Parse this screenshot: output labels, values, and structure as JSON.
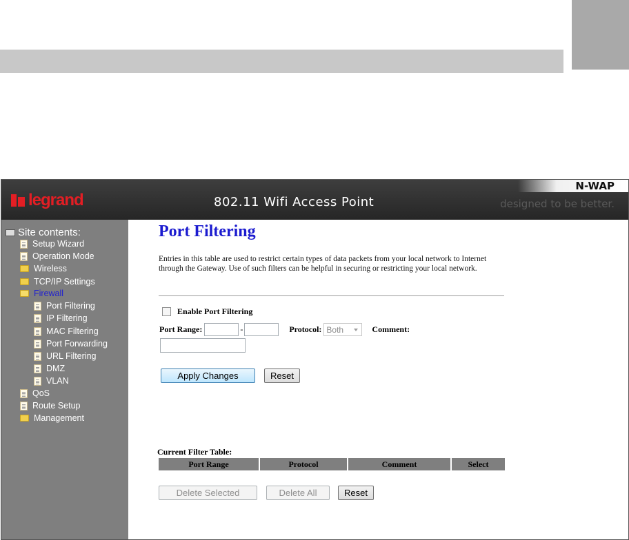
{
  "header": {
    "logo": "legrand",
    "title": "802.11 Wifi Access Point",
    "product": "N-WAP",
    "tagline": "designed to be better."
  },
  "sidebar": {
    "title": "Site contents:",
    "items": [
      {
        "label": "Setup Wizard",
        "icon": "document-icon"
      },
      {
        "label": "Operation Mode",
        "icon": "document-icon"
      },
      {
        "label": "Wireless",
        "icon": "folder-icon"
      },
      {
        "label": "TCP/IP Settings",
        "icon": "folder-icon"
      },
      {
        "label": "Firewall",
        "icon": "folder-open-icon",
        "active": true
      },
      {
        "label": "Port Filtering",
        "icon": "document-icon"
      },
      {
        "label": "IP Filtering",
        "icon": "document-icon"
      },
      {
        "label": "MAC Filtering",
        "icon": "document-icon"
      },
      {
        "label": "Port Forwarding",
        "icon": "document-icon"
      },
      {
        "label": "URL Filtering",
        "icon": "document-icon"
      },
      {
        "label": "DMZ",
        "icon": "document-icon"
      },
      {
        "label": "VLAN",
        "icon": "document-icon"
      },
      {
        "label": "QoS",
        "icon": "document-icon"
      },
      {
        "label": "Route Setup",
        "icon": "document-icon"
      },
      {
        "label": "Management",
        "icon": "folder-icon"
      }
    ]
  },
  "main": {
    "title": "Port Filtering",
    "description": "Entries in this table are used to restrict certain types of data packets from your local network to Internet through the Gateway. Use of such filters can be helpful in securing or restricting your local network.",
    "enable_label": "Enable Port Filtering",
    "enable_checked": false,
    "port_range_label": "Port Range:",
    "port_range_from": "",
    "port_range_to": "",
    "range_separator": "-",
    "protocol_label": "Protocol:",
    "protocol_value": "Both",
    "comment_label": "Comment:",
    "comment_value": "",
    "apply_label": "Apply Changes",
    "reset_label": "Reset",
    "table_title": "Current Filter Table:",
    "table_columns": [
      "Port Range",
      "Protocol",
      "Comment",
      "Select"
    ],
    "delete_selected_label": "Delete Selected",
    "delete_all_label": "Delete All",
    "reset2_label": "Reset"
  },
  "colors": {
    "header_bg": "#2e2e2e",
    "sidebar_bg": "#7f7f7f",
    "title_blue": "#1b1bcf",
    "brand_red": "#e31e24"
  }
}
